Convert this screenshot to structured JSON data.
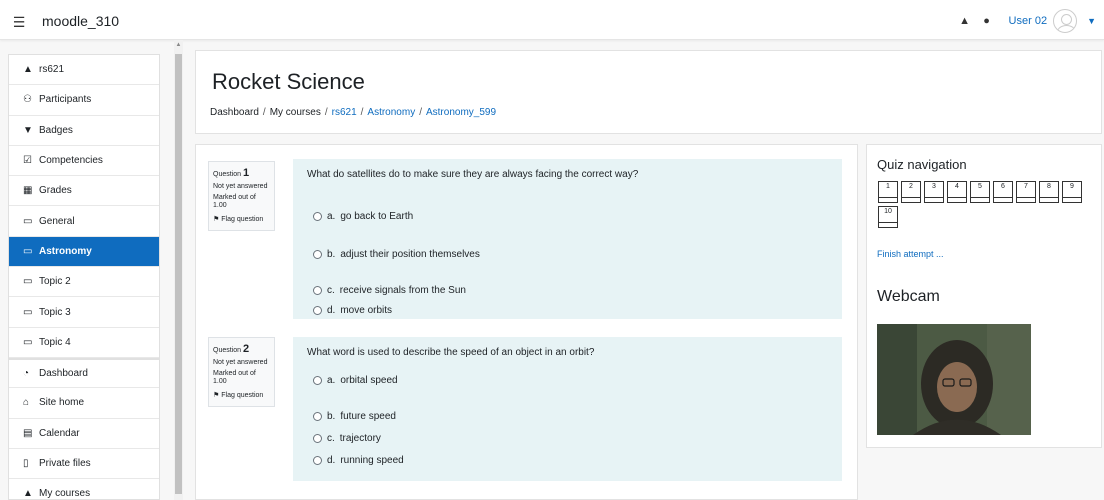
{
  "navbar": {
    "site_name": "moodle_310",
    "user_name": "User 02"
  },
  "sidebar": {
    "items": [
      {
        "label": "rs621",
        "icon": "graduation-cap-icon",
        "glyph": "▲"
      },
      {
        "label": "Participants",
        "icon": "users-icon",
        "glyph": "⚇"
      },
      {
        "label": "Badges",
        "icon": "shield-icon",
        "glyph": "▼"
      },
      {
        "label": "Competencies",
        "icon": "checkbox-icon",
        "glyph": "☑"
      },
      {
        "label": "Grades",
        "icon": "table-icon",
        "glyph": "▦"
      },
      {
        "label": "General",
        "icon": "folder-icon",
        "glyph": "▭"
      },
      {
        "label": "Astronomy",
        "icon": "folder-icon",
        "glyph": "▭"
      },
      {
        "label": "Topic 2",
        "icon": "folder-icon",
        "glyph": "▭"
      },
      {
        "label": "Topic 3",
        "icon": "folder-icon",
        "glyph": "▭"
      },
      {
        "label": "Topic 4",
        "icon": "folder-icon",
        "glyph": "▭"
      },
      {
        "label": "Dashboard",
        "icon": "dashboard-icon",
        "glyph": "◔"
      },
      {
        "label": "Site home",
        "icon": "home-icon",
        "glyph": "⌂"
      },
      {
        "label": "Calendar",
        "icon": "calendar-icon",
        "glyph": "▤"
      },
      {
        "label": "Private files",
        "icon": "file-icon",
        "glyph": "▯"
      },
      {
        "label": "My courses",
        "icon": "graduation-cap-icon",
        "glyph": "▲"
      }
    ],
    "active_index": 6
  },
  "header": {
    "title": "Rocket Science",
    "breadcrumb": [
      "Dashboard",
      "My courses",
      "rs621",
      "Astronomy",
      "Astronomy_599"
    ],
    "separator": "/"
  },
  "questions": [
    {
      "label": "Question",
      "number": "1",
      "state": "Not yet answered",
      "marks": "Marked out of 1.00",
      "flag": "Flag question",
      "text": "What do satellites do to make sure they are always facing the correct way?",
      "answers": [
        {
          "letter": "a.",
          "text": "go back to Earth"
        },
        {
          "letter": "b.",
          "text": "adjust their position themselves"
        },
        {
          "letter": "c.",
          "text": "receive signals from the Sun"
        },
        {
          "letter": "d.",
          "text": "move orbits"
        }
      ]
    },
    {
      "label": "Question",
      "number": "2",
      "state": "Not yet answered",
      "marks": "Marked out of 1.00",
      "flag": "Flag question",
      "text": "What word is used to describe the speed of an object in an orbit?",
      "answers": [
        {
          "letter": "a.",
          "text": "orbital speed"
        },
        {
          "letter": "b.",
          "text": "future speed"
        },
        {
          "letter": "c.",
          "text": "trajectory"
        },
        {
          "letter": "d.",
          "text": "running speed"
        }
      ]
    }
  ],
  "quiz_nav": {
    "title": "Quiz navigation",
    "buttons": [
      "1",
      "2",
      "3",
      "4",
      "5",
      "6",
      "7",
      "8",
      "9",
      "10"
    ],
    "finish": "Finish attempt ..."
  },
  "webcam": {
    "title": "Webcam"
  },
  "colors": {
    "accent": "#0f6cbf",
    "question_bg": "#e7f3f5"
  }
}
